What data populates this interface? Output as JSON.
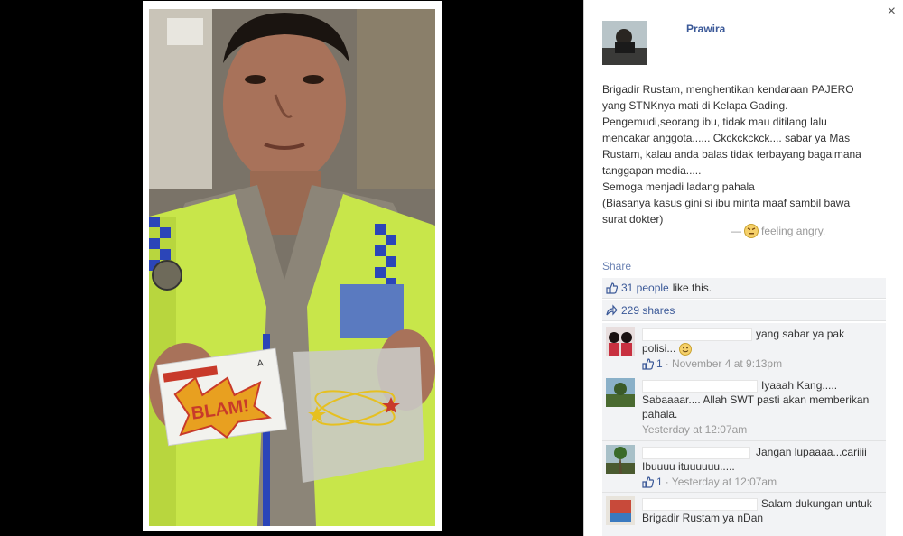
{
  "post": {
    "author": "Prawira",
    "close_icon": "×",
    "lines": [
      "Brigadir Rustam, menghentikan kendaraan PAJERO",
      "yang STNKnya mati di Kelapa Gading.",
      "Pengemudi,seorang ibu, tidak mau ditilang lalu",
      "mencakar anggota...... Ckckckckck.... sabar ya Mas",
      "Rustam, kalau anda balas tidak terbayang bagaimana",
      "tanggapan media.....",
      "Semoga menjadi ladang pahala",
      "(Biasanya kasus gini si ibu minta maaf sambil bawa",
      "surat dokter)"
    ],
    "feeling_prefix": "—",
    "feeling": "feeling angry.",
    "share_label": "Share",
    "likes_link": "31 people",
    "likes_suffix": "like this.",
    "shares_label": "229 shares"
  },
  "photo": {
    "card_sticker": "BLAM!",
    "card_a": "A"
  },
  "comments": [
    {
      "text_line1": "yang sabar ya pak",
      "text_line2": "polisi...",
      "likes": "1",
      "time": "· November 4 at 9:13pm"
    },
    {
      "text_line1": "Iyaaah Kang.....",
      "text_line2": "Sabaaaar.... Allah SWT pasti akan memberikan",
      "text_line3": "pahala.",
      "time": "Yesterday at 12:07am"
    },
    {
      "text_line1": "Jangan lupaaaa...cariiii",
      "text_line2": "Ibuuuu ituuuuuu.....",
      "likes": "1",
      "time": "· Yesterday at 12:07am"
    },
    {
      "text_line1": "Salam dukungan untuk",
      "text_line2": "Brigadir Rustam ya nDan"
    }
  ],
  "colors": {
    "link": "#3b5998",
    "muted": "#999999",
    "vest": "#c8e64a"
  }
}
